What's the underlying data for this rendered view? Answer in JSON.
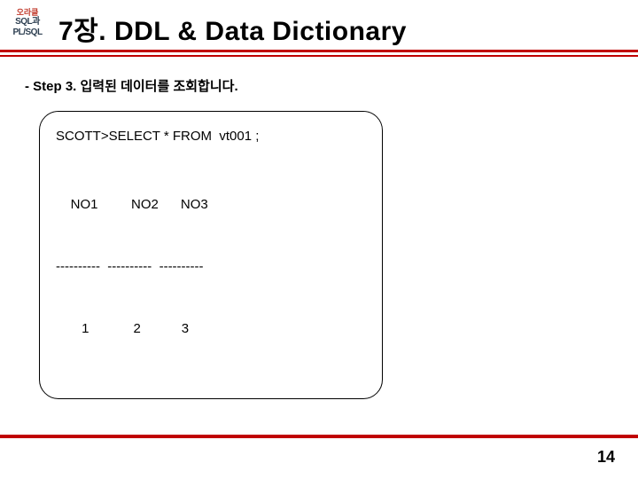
{
  "logo": {
    "top": "오라클",
    "mid": "SQL과\nPL/SQL"
  },
  "title": "7장. DDL & Data Dictionary",
  "step": "- Step 3. 입력된 데이터를 조회합니다.",
  "code": {
    "query": "SCOTT>SELECT * FROM  vt001 ;",
    "headers": "    NO1         NO2      NO3",
    "sep": "----------  ----------  ----------",
    "row": "       1            2           3"
  },
  "page": "14"
}
